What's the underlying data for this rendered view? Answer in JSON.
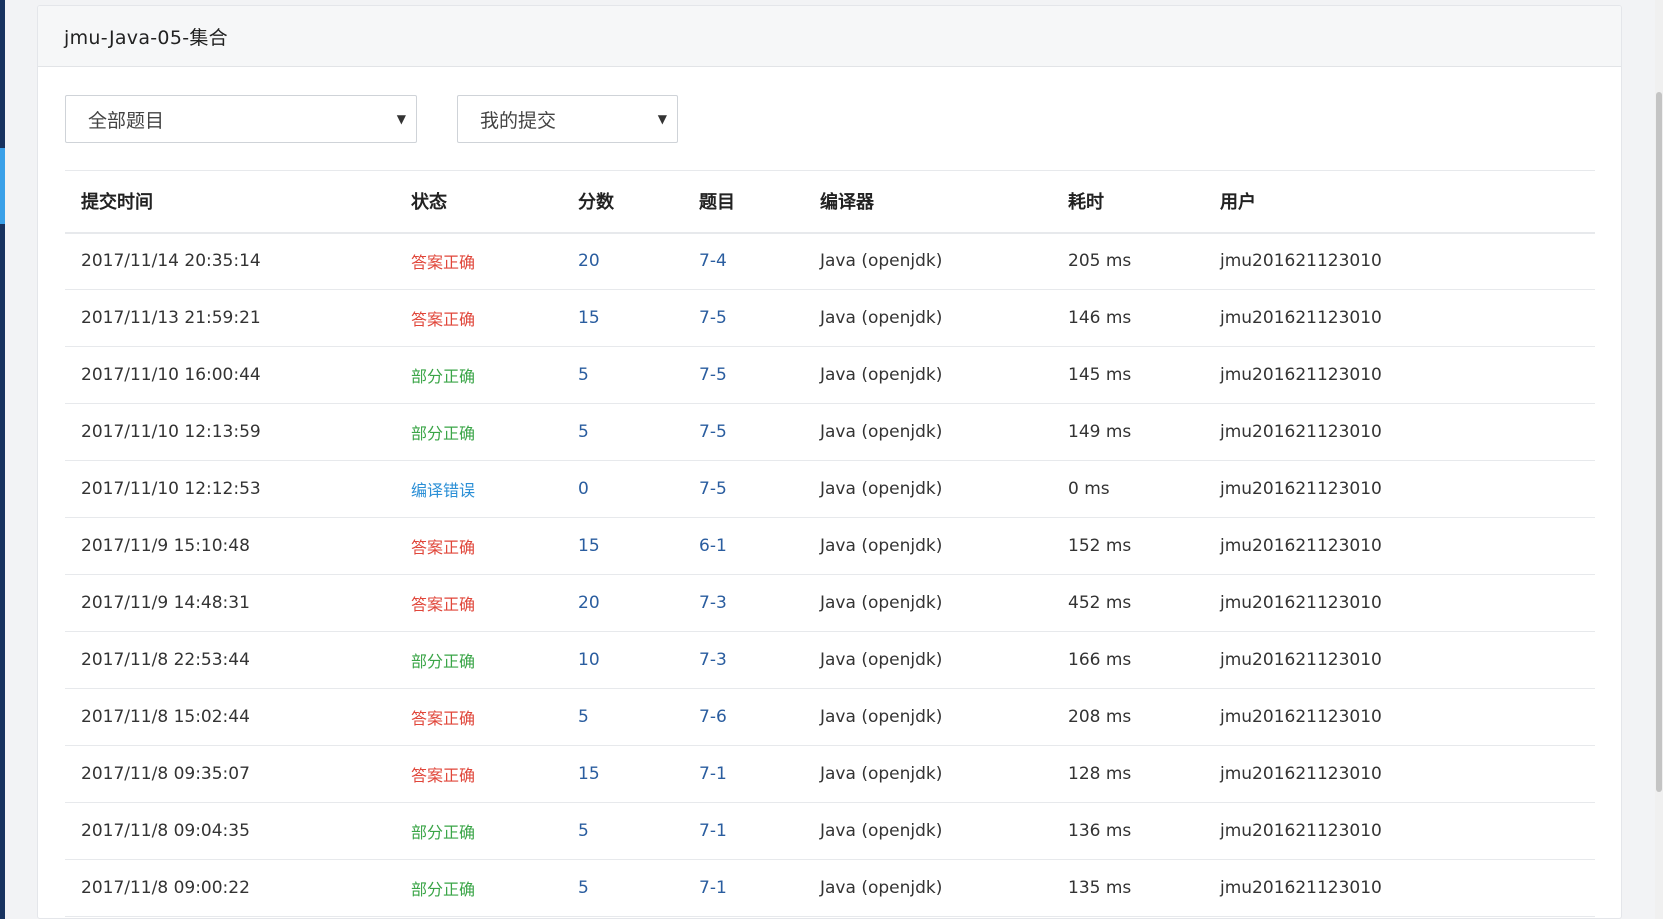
{
  "card": {
    "title": "jmu-Java-05-集合"
  },
  "filters": {
    "problem_select": "全部题目",
    "submission_select": "我的提交"
  },
  "table": {
    "headers": [
      "提交时间",
      "状态",
      "分数",
      "题目",
      "编译器",
      "耗时",
      "用户"
    ],
    "rows": [
      {
        "time": "2017/11/14 20:35:14",
        "status": "答案正确",
        "status_type": "correct",
        "score": "20",
        "problem": "7-4",
        "compiler": "Java (openjdk)",
        "duration": "205 ms",
        "user": "jmu201621123010"
      },
      {
        "time": "2017/11/13 21:59:21",
        "status": "答案正确",
        "status_type": "correct",
        "score": "15",
        "problem": "7-5",
        "compiler": "Java (openjdk)",
        "duration": "146 ms",
        "user": "jmu201621123010"
      },
      {
        "time": "2017/11/10 16:00:44",
        "status": "部分正确",
        "status_type": "partial",
        "score": "5",
        "problem": "7-5",
        "compiler": "Java (openjdk)",
        "duration": "145 ms",
        "user": "jmu201621123010"
      },
      {
        "time": "2017/11/10 12:13:59",
        "status": "部分正确",
        "status_type": "partial",
        "score": "5",
        "problem": "7-5",
        "compiler": "Java (openjdk)",
        "duration": "149 ms",
        "user": "jmu201621123010"
      },
      {
        "time": "2017/11/10 12:12:53",
        "status": "编译错误",
        "status_type": "compile",
        "score": "0",
        "problem": "7-5",
        "compiler": "Java (openjdk)",
        "duration": "0 ms",
        "user": "jmu201621123010"
      },
      {
        "time": "2017/11/9 15:10:48",
        "status": "答案正确",
        "status_type": "correct",
        "score": "15",
        "problem": "6-1",
        "compiler": "Java (openjdk)",
        "duration": "152 ms",
        "user": "jmu201621123010"
      },
      {
        "time": "2017/11/9 14:48:31",
        "status": "答案正确",
        "status_type": "correct",
        "score": "20",
        "problem": "7-3",
        "compiler": "Java (openjdk)",
        "duration": "452 ms",
        "user": "jmu201621123010"
      },
      {
        "time": "2017/11/8 22:53:44",
        "status": "部分正确",
        "status_type": "partial",
        "score": "10",
        "problem": "7-3",
        "compiler": "Java (openjdk)",
        "duration": "166 ms",
        "user": "jmu201621123010"
      },
      {
        "time": "2017/11/8 15:02:44",
        "status": "答案正确",
        "status_type": "correct",
        "score": "5",
        "problem": "7-6",
        "compiler": "Java (openjdk)",
        "duration": "208 ms",
        "user": "jmu201621123010"
      },
      {
        "time": "2017/11/8 09:35:07",
        "status": "答案正确",
        "status_type": "correct",
        "score": "15",
        "problem": "7-1",
        "compiler": "Java (openjdk)",
        "duration": "128 ms",
        "user": "jmu201621123010"
      },
      {
        "time": "2017/11/8 09:04:35",
        "status": "部分正确",
        "status_type": "partial",
        "score": "5",
        "problem": "7-1",
        "compiler": "Java (openjdk)",
        "duration": "136 ms",
        "user": "jmu201621123010"
      },
      {
        "time": "2017/11/8 09:00:22",
        "status": "部分正确",
        "status_type": "partial",
        "score": "5",
        "problem": "7-1",
        "compiler": "Java (openjdk)",
        "duration": "135 ms",
        "user": "jmu201621123010"
      }
    ]
  },
  "colors": {
    "correct": "#e0463a",
    "partial": "#3aa547",
    "compile_error": "#2b8fd6",
    "link": "#2a5d9f",
    "sidebar": "#17325f",
    "sidebar_accent": "#3aa0e8"
  },
  "icons": {
    "select_caret": "caret-down-icon"
  }
}
